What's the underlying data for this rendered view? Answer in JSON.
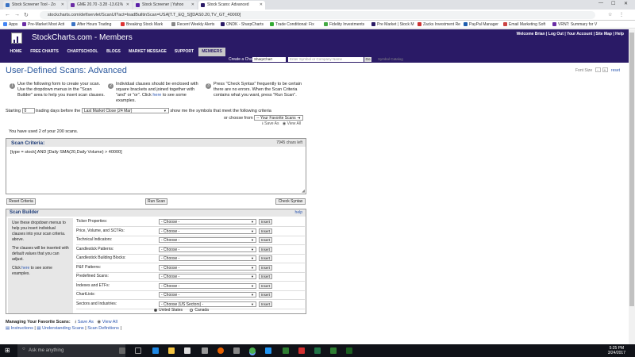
{
  "browser": {
    "tabs": [
      {
        "label": "Stock Screener Tool - Zo"
      },
      {
        "label": "GME 20.70 -3.28 -13.61%"
      },
      {
        "label": "Stock Screener | Yahoo"
      },
      {
        "label": "Stock Scans: Advanced"
      }
    ],
    "url": "stockcharts.com/def/servlet/ScanUI?act=loadBuiltinScan=USA[T.T_EQ_S][DAS0.20,TV_GT_40000]",
    "bookmarks": [
      "Apps",
      "Pre-Market Most Acti",
      "After Hours Trading",
      "Breaking Stock Mark",
      "Recent Weekly Alerts",
      "ONDK - SharpCharts",
      "Trade Conditional: Fix",
      "Fidelity Investments",
      "Pre Market | Stock M",
      "Zacks Investment Re",
      "PayPal Manager",
      "Email Marketing Soft",
      "VRNT: Summary for V"
    ]
  },
  "site": {
    "title": "StockCharts.com - Members",
    "welcome": "Welcome Brian | Log Out | Your Account | Site Map | Help",
    "nav": [
      "HOME",
      "FREE CHARTS",
      "CHARTSCHOOL",
      "BLOGS",
      "MARKET MESSAGE",
      "SUPPORT",
      "MEMBERS"
    ],
    "create_chart_label": "Create a Chart:",
    "chart_type": "SharpChart",
    "symbol_placeholder": "Enter Symbol or Company Name",
    "go_label": "Go",
    "symbol_catalog": "Symbol Catalog"
  },
  "page": {
    "title": "User-Defined Scans: Advanced",
    "font_size_label": "Font Size",
    "font_minus": "-",
    "font_plus": "+",
    "reset_label": "reset",
    "steps": [
      {
        "num": "1",
        "text": "Use the following form to create your scan. Use the dropdown menus in the \"Scan Builder\" area to help you insert scan clauses."
      },
      {
        "num": "2",
        "text_before": "Individual clauses should be enclosed with square brackets and joined together with \"and\" or \"or\". Click",
        "link": "here",
        "text_after": "to see some examples."
      },
      {
        "num": "3",
        "text": "Press \"Check Syntax\" frequently to be certain there are no errors. When the Scan Criteria contains what you want, press \"Run Scan\"."
      }
    ],
    "starting_label": "Starting",
    "starting_value": "0",
    "trading_days_label": "trading days before the",
    "market_close_value": "Last Market Close (24 Mar)",
    "show_me_label": "show me the symbols that meet the following criteria",
    "or_choose_label": "or choose from",
    "favorite_scans": "-- Your Favorite Scans --",
    "save_as": "Save As",
    "view_all": "View All",
    "used_scans": "You have used 2 of your 200 scans.",
    "criteria_title": "Scan Criteria:",
    "chars_left": "7945 chars left",
    "criteria_text": "[type = stock] AND [Daily SMA(20,Daily Volume) > 40000]",
    "reset_criteria": "Reset Criteria",
    "run_scan": "Run Scan",
    "check_syntax": "Check Syntax"
  },
  "builder": {
    "title": "Scan Builder",
    "help": "help",
    "side_text_1": "Use these dropdown menus to help you insert individual clauses into your scan criteria. above.",
    "side_text_2": "The clauses will be inserted with default values that you can adjust.",
    "side_text_3_pre": "Click",
    "side_link": "here",
    "side_text_3_post": "to see some examples.",
    "rows": [
      {
        "label": "Ticker Properties:",
        "value": "- Choose -"
      },
      {
        "label": "Price, Volume, and SCTRs:",
        "value": "- Choose -"
      },
      {
        "label": "Technical Indicators:",
        "value": "- Choose -"
      },
      {
        "label": "Candlestick Patterns:",
        "value": "- Choose -"
      },
      {
        "label": "Candlestick Building Blocks:",
        "value": "- Choose -"
      },
      {
        "label": "P&F Patterns:",
        "value": "- Choose -"
      },
      {
        "label": "Predefined Scans:",
        "value": "- Choose -"
      },
      {
        "label": "Indexes and ETFs:",
        "value": "- Choose -"
      },
      {
        "label": "ChartLists:",
        "value": "- Choose -"
      },
      {
        "label": "Sectors and Industries:",
        "value": "- Choose (US Sectors) -"
      }
    ],
    "insert_label": "Insert",
    "radio_us": "United States",
    "radio_ca": "Canada"
  },
  "footer": {
    "managing_label": "Managing Your Favorite Scans:",
    "save_as": "Save As",
    "view_all": "View All",
    "instructions": "Instructions",
    "understanding": "Understanding Scans",
    "definitions": "Scan Definitions"
  },
  "taskbar": {
    "search_placeholder": "Ask me anything",
    "time": "5:25 PM",
    "date": "3/24/2017"
  }
}
